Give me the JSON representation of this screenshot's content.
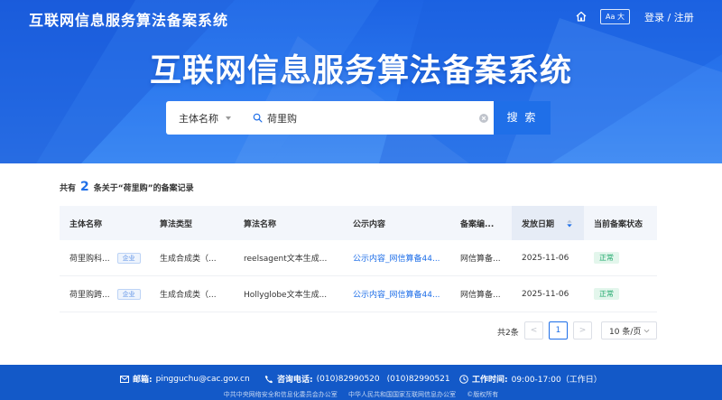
{
  "header": {
    "brand": "互联网信息服务算法备案系统",
    "font_button": "Aa 大",
    "login": "登录 / 注册"
  },
  "hero": {
    "title": "互联网信息服务算法备案系统"
  },
  "search": {
    "type_value": "主体名称",
    "query": "荷里购",
    "button": "搜 索"
  },
  "results": {
    "prefix": "共有",
    "count": "2",
    "suffix": "条关于“荷里购”的备案记录",
    "columns": [
      "主体名称",
      "算法类型",
      "算法名称",
      "公示内容",
      "备案编...",
      "发放日期",
      "当前备案状态"
    ],
    "rows": [
      {
        "subject": "荷里购科...",
        "tag": "企业",
        "algo_type": "生成合成类（...",
        "algo_name": "reelsagent文本生成...",
        "publicity": "公示内容_网信算备44...",
        "record_no": "网信算备...",
        "date": "2025-11-06",
        "status": "正常"
      },
      {
        "subject": "荷里购跨...",
        "tag": "企业",
        "algo_type": "生成合成类（...",
        "algo_name": "Hollyglobe文本生成...",
        "publicity": "公示内容_网信算备44...",
        "record_no": "网信算备...",
        "date": "2025-11-06",
        "status": "正常"
      }
    ]
  },
  "pagination": {
    "total": "共2条",
    "prev": "<",
    "current": "1",
    "next": ">",
    "page_size": "10 条/页"
  },
  "footer": {
    "email_label": "邮箱:",
    "email": "pingguchu@cac.gov.cn",
    "phone_label": "咨询电话:",
    "phone1": "(010)82990520",
    "phone2": "(010)82990521",
    "hours_label": "工作时间:",
    "hours": "09:00-17:00（工作日）",
    "org1": "中共中央网络安全和信息化委员会办公室",
    "org2": "中华人民共和国国家互联网信息办公室",
    "copyright": "©版权所有"
  },
  "colors": {
    "primary": "#1f6fe8",
    "hero_blue": "#2a77ee",
    "footer_blue": "#1359c8",
    "status_green": "#1fa86b"
  },
  "icons": [
    "home-icon",
    "search-icon",
    "clear-icon",
    "sort-icon",
    "chevron-down-icon",
    "mail-icon",
    "phone-icon",
    "clock-icon"
  ]
}
